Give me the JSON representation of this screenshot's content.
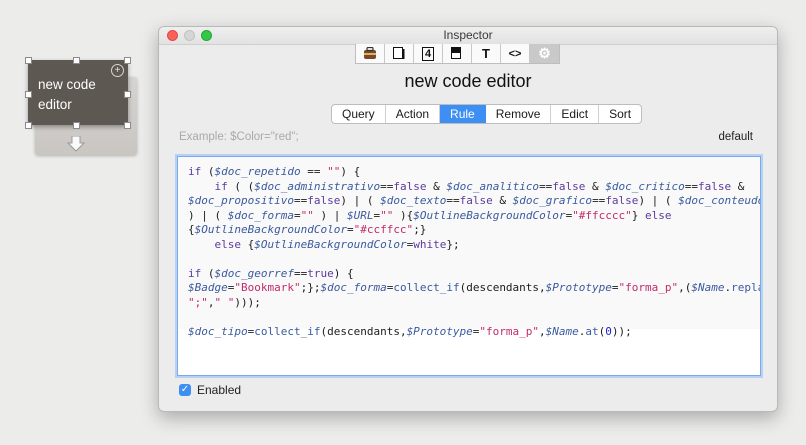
{
  "canvas": {
    "note_text": "new code\neditor"
  },
  "inspector": {
    "window_title": "Inspector",
    "toolbar_icons": [
      "bag-icon",
      "document-icon",
      "number-four-icon",
      "page-shadow-icon",
      "text-t-icon",
      "code-icon",
      "gear-icon"
    ],
    "toolbar_glyphs": [
      "▣",
      "□",
      "4",
      "■",
      "T",
      "<>",
      "⚙"
    ],
    "heading": "new code editor",
    "tabs": [
      "Query",
      "Action",
      "Rule",
      "Remove",
      "Edict",
      "Sort"
    ],
    "active_tab": "Rule",
    "example_placeholder": "Example: $Color=\"red\";",
    "default_label": "default",
    "code_lines": [
      "if ($doc_repetido == \"\") {",
      "    if ( ($doc_administrativo==false & $doc_analitico==false & $doc_critico==false &",
      "$doc_propositivo==false) | ( $doc_texto==false & $doc_grafico==false) | ( $doc_conteudo=\"\"",
      ") | ( $doc_forma=\"\" ) | $URL=\"\" ){$OutlineBackgroundColor=\"#ffcccc\"} else",
      "{$OutlineBackgroundColor=\"#ccffcc\";}",
      "    else {$OutlineBackgroundColor=white};",
      "",
      "if ($doc_georref==true) {",
      "$Badge=\"Bookmark\";};$doc_forma=collect_if(descendants,$Prototype=\"forma_p\",($Name.replace(",
      "\";\",\" \")));",
      "",
      "$doc_tipo=collect_if(descendants,$Prototype=\"forma_p\",$Name.at(0));"
    ],
    "enabled_label": "Enabled",
    "enabled_checked": true
  }
}
